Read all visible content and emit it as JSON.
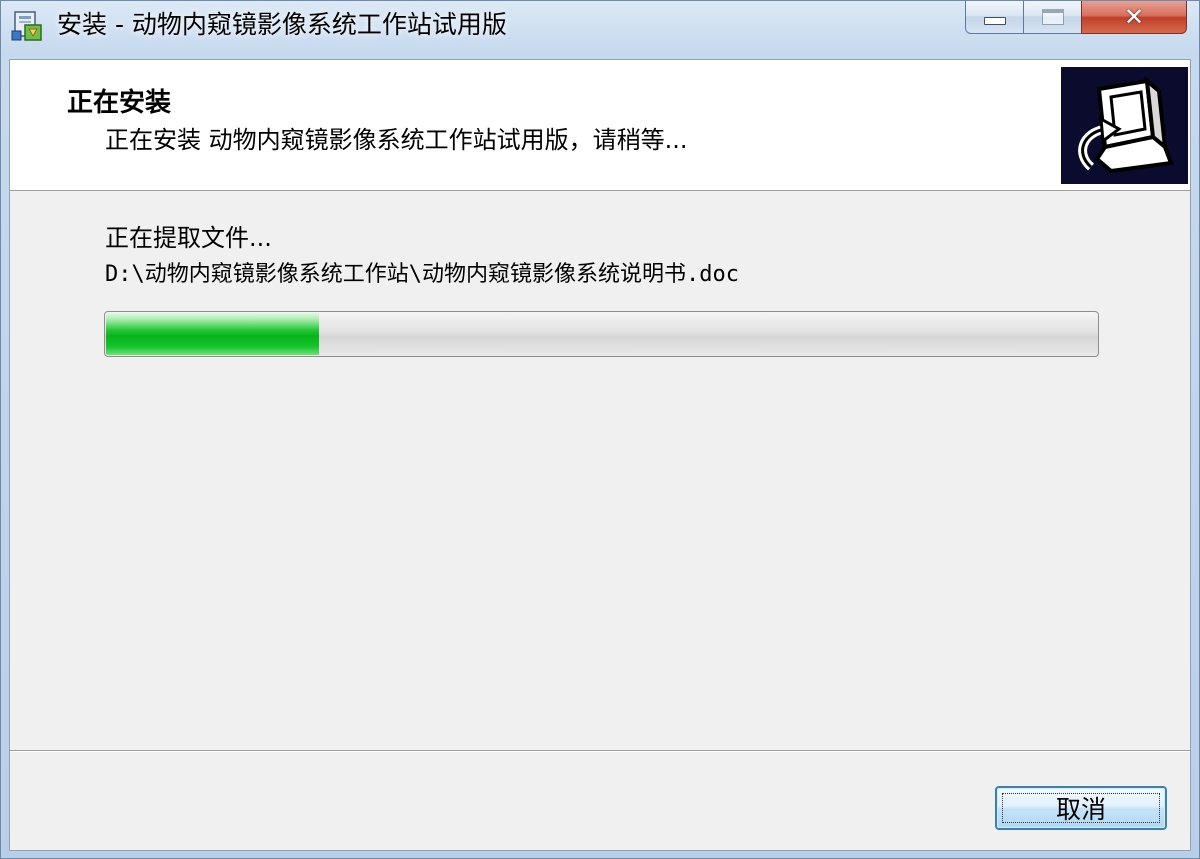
{
  "window": {
    "title": "安装 - 动物内窥镜影像系统工作站试用版",
    "icon": "installer-icon",
    "controls": [
      "minimize",
      "maximize",
      "close"
    ]
  },
  "header": {
    "title": "正在安装",
    "subtitle": "正在安装 动物内窥镜影像系统工作站试用版，请稍等..."
  },
  "body": {
    "status": "正在提取文件...",
    "current_file": "D:\\动物内窥镜影像系统工作站\\动物内窥镜影像系统说明书.doc",
    "progress_fraction": 0.215,
    "progress_color": "#06b41c"
  },
  "footer": {
    "cancel_label": "取消"
  }
}
